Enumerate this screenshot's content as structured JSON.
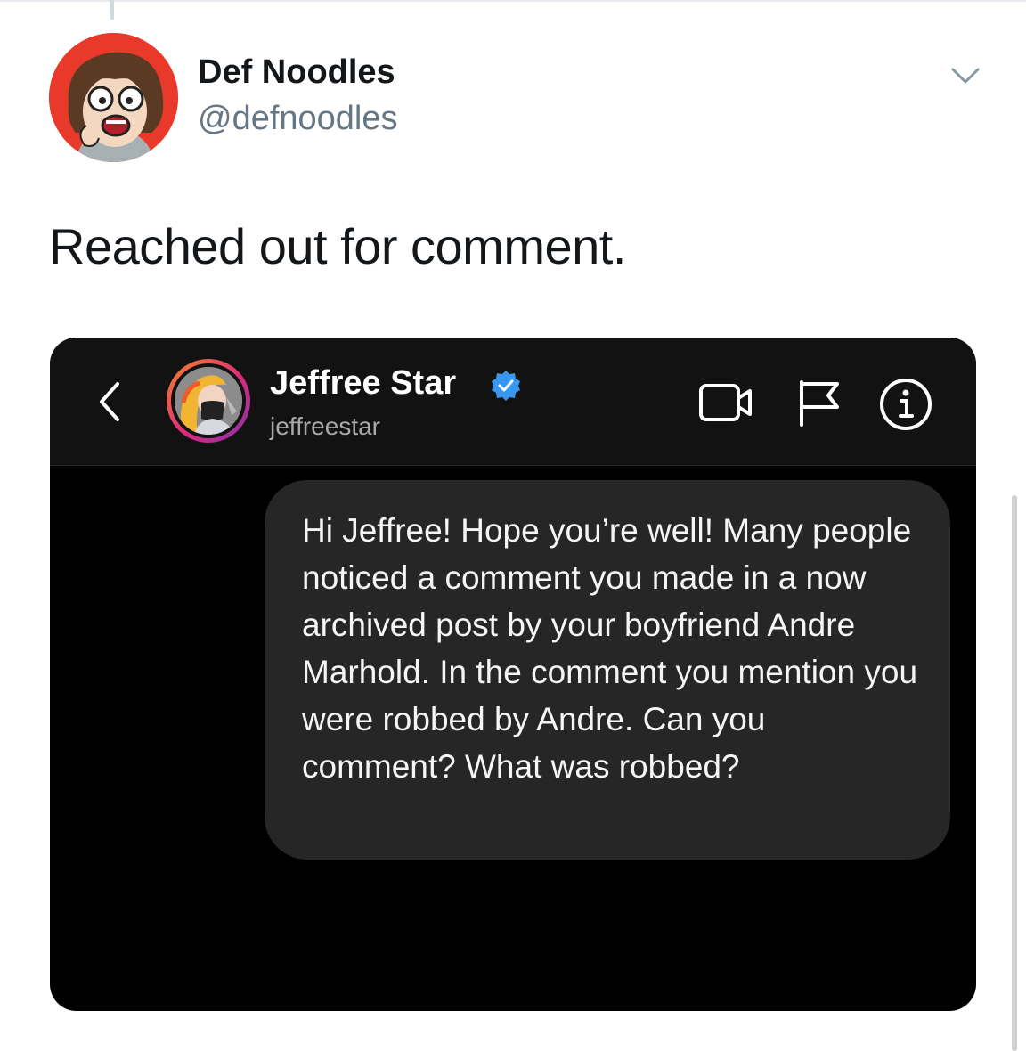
{
  "tweet": {
    "author": {
      "display_name": "Def Noodles",
      "handle": "@defnoodles"
    },
    "text": "Reached out for comment.",
    "menu_icon": "chevron-down-icon"
  },
  "dm_screenshot": {
    "header": {
      "back_icon": "chevron-left-icon",
      "contact_name": "Jeffree Star",
      "contact_username": "jeffreestar",
      "verified": true,
      "verified_color": "#3897f0",
      "actions": [
        "video-call-icon",
        "flag-icon",
        "info-icon"
      ]
    },
    "messages": [
      {
        "sender": "self",
        "text": "Hi Jeffree! Hope you’re well! Many people noticed a comment you made in a now archived post by your boyfriend Andre Marhold. In the comment you mention you were robbed by Andre. Can you comment? What was robbed?"
      }
    ],
    "colors": {
      "background": "#000000",
      "header": "#121212",
      "bubble": "#262626",
      "text": "#f5f5f5"
    }
  },
  "colors": {
    "name_text": "#14171a",
    "handle_text": "#657786"
  }
}
